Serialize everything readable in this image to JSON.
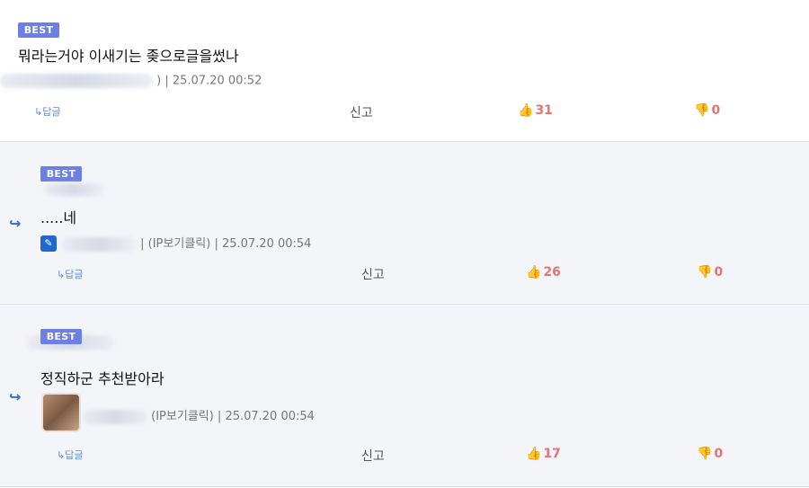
{
  "comments": [
    {
      "badge": "BEST",
      "text": "뭐라는거야 이새기는 좆으로글을썼나",
      "meta": ") | 25.07.20 00:52",
      "reply": "↳답글",
      "report": "신고",
      "likes": "31",
      "dislikes": "0"
    },
    {
      "badge": "BEST",
      "text": ".....네",
      "meta": "| (IP보기클릭) | 25.07.20 00:54",
      "reply": "↳답글",
      "report": "신고",
      "likes": "26",
      "dislikes": "0"
    },
    {
      "badge": "BEST",
      "text": "정직하군 추천받아라",
      "meta": "(IP보기클릭) | 25.07.20 00:54",
      "reply": "↳답글",
      "report": "신고",
      "likes": "17",
      "dislikes": "0"
    }
  ],
  "icons": {
    "reply_arrow": "↪",
    "thumb_up": "👍",
    "thumb_down": "👎",
    "edit": "✎"
  },
  "colors": {
    "badge": "#6b7fe6",
    "likes": "#e57373",
    "reply_arrow": "#2d6fd6",
    "reply_background": "#f4f5f8"
  }
}
